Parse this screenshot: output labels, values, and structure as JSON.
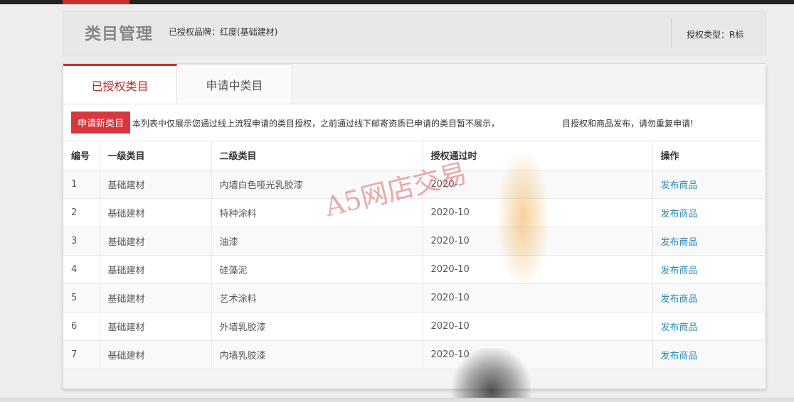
{
  "header": {
    "title": "类目管理",
    "brand": "已授权品牌：红度(基础建材)",
    "auth_type": "授权类型：R标"
  },
  "tabs": [
    {
      "label": "已授权类目",
      "active": true
    },
    {
      "label": "申请中类目",
      "active": false
    }
  ],
  "notice": {
    "button_label": "申请新类目",
    "text": "本列表中仅展示您通过线上流程申请的类目授权，之前通过线下邮寄资质已申请的类目暂不展示，",
    "text_end": "目授权和商品发布，请勿重复申请!"
  },
  "table": {
    "headers": [
      "编号",
      "一级类目",
      "二级类目",
      "授权通过时",
      "操作"
    ],
    "rows": [
      {
        "id": "1",
        "level1": "基础建材",
        "level2": "内墙白色哑光乳胶漆",
        "date": "2020-",
        "action": "发布商品"
      },
      {
        "id": "2",
        "level1": "基础建材",
        "level2": "特种涂料",
        "date": "2020-10",
        "action": "发布商品"
      },
      {
        "id": "3",
        "level1": "基础建材",
        "level2": "油漆",
        "date": "2020-10",
        "action": "发布商品"
      },
      {
        "id": "4",
        "level1": "基础建材",
        "level2": "硅藻泥",
        "date": "2020-10",
        "action": "发布商品"
      },
      {
        "id": "5",
        "level1": "基础建材",
        "level2": "艺术涂料",
        "date": "2020-10",
        "action": "发布商品"
      },
      {
        "id": "6",
        "level1": "基础建材",
        "level2": "外墙乳胶漆",
        "date": "2020-10",
        "action": "发布商品"
      },
      {
        "id": "7",
        "level1": "基础建材",
        "level2": "内墙乳胶漆",
        "date": "2020-10",
        "action": "发布商品"
      }
    ]
  },
  "watermark": "A5网店交易",
  "colors": {
    "accent": "#c9302c",
    "button": "#d9363e",
    "link": "#2a8ab8"
  }
}
